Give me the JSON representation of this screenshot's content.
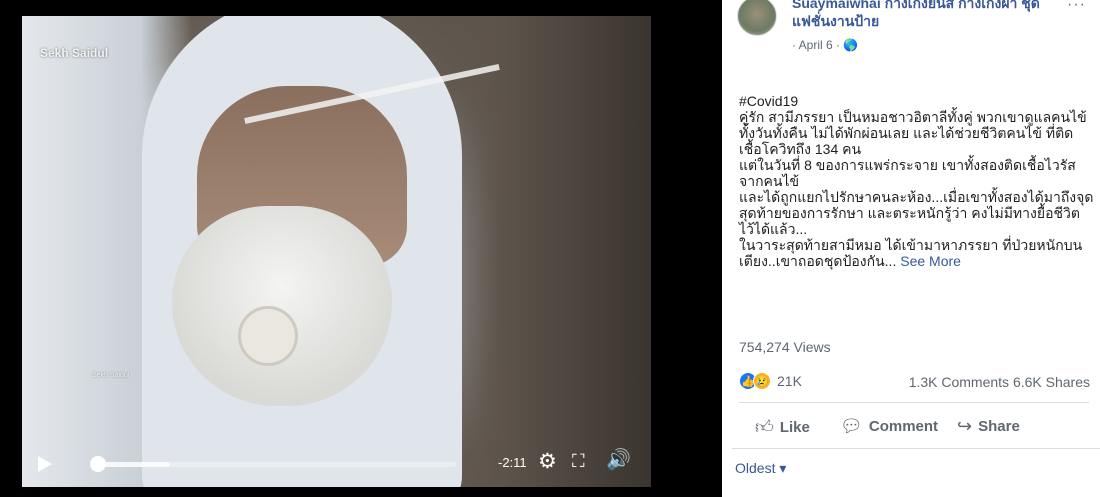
{
  "video": {
    "watermark": "Sekh Saidul",
    "watermark_small": "Sekh Saidul",
    "time_remaining": "-2:11",
    "progress": 0.2,
    "icons": {
      "play": "play-icon",
      "settings": "gear-icon",
      "fullscreen": "fullscreen-icon",
      "volume": "volume-icon"
    }
  },
  "post": {
    "author": "Suaymaiwhai กางเกงยีนส์ กางเกงผ้า ชุดแฟชั่นงานป้าย",
    "meta": "· April 6 · 🌎",
    "more": "···",
    "body_lines": [
      "#Covid19",
      "คู่รัก สามีภรรยา เป็นหมอชาวอิตาลีทั้งคู่ พวกเขาดูแลคนไข้ทั้งวันทั้งคืน ไม่ได้พักผ่อนเลย และได้ช่วยชีวิตคนไข้ ที่ติดเชื้อโควิทถึง 134 คน",
      "แต่ในวันที่ 8 ของการแพร่กระจาย เขาทั้งสองติดเชื้อไวรัสจากคนไข้",
      "และได้ถูกแยกไปรักษาคนละห้อง...เมื่อเขาทั้งสองได้มาถึงจุดสุดท้ายของการรักษา และตระหนักรู้ว่า คงไม่มีทางยื้อชีวิตไว้ได้แล้ว...",
      "ในวาระสุดท้ายสามีหมอ ได้เข้ามาหาภรรยา ที่ป่วยหนักบนเตียง..เขาถอดชุดป้องกัน..."
    ],
    "see_more": "See More",
    "views": "754,274 Views",
    "reaction_count": "21K",
    "comments_shares": "1.3K Comments  6.6K Shares",
    "actions": {
      "like": "Like",
      "comment": "Comment",
      "share": "Share"
    },
    "sort": "Oldest ▾"
  }
}
